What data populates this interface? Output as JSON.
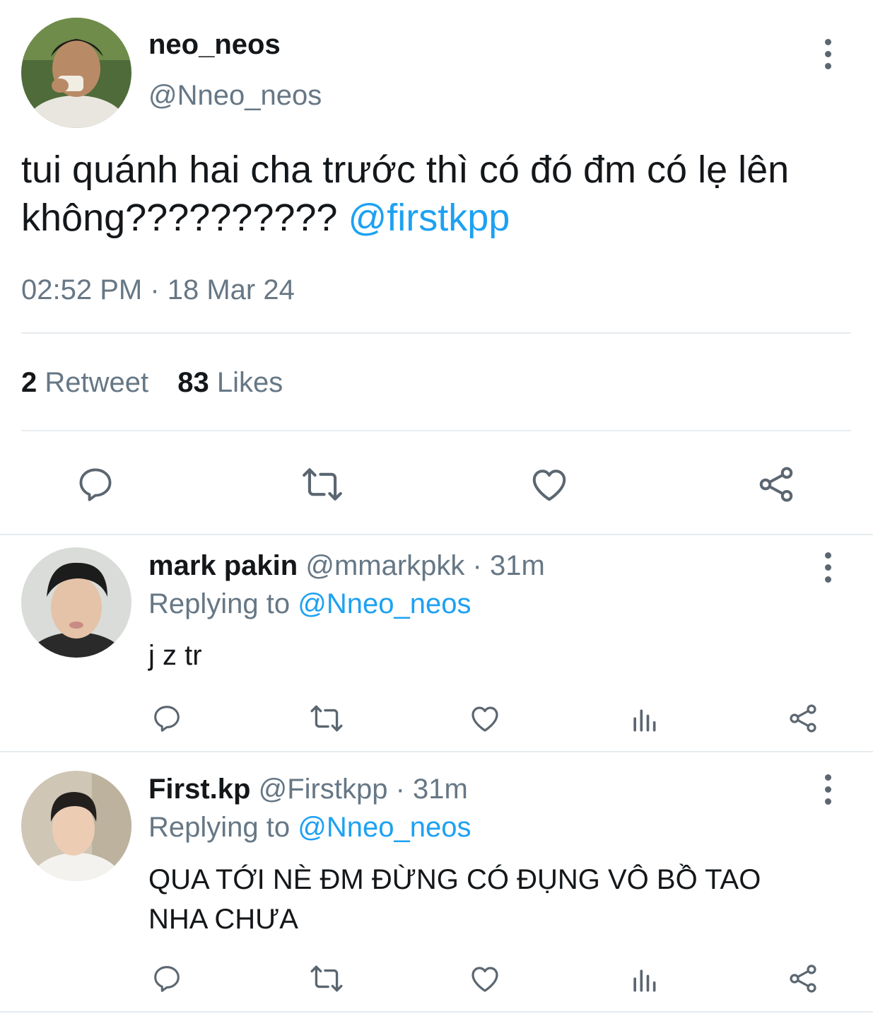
{
  "main_tweet": {
    "display_name": "neo_neos",
    "handle": "@Nneo_neos",
    "text": "tui quánh hai cha trước thì có đó đm có lẹ lên không??????????",
    "mention": "@firstkpp",
    "timestamp": "02:52 PM · 18 Mar 24",
    "retweet_count": "2",
    "retweet_label": "Retweet",
    "likes_count": "83",
    "likes_label": "Likes"
  },
  "replies": [
    {
      "display_name": "mark pakin",
      "handle": "@mmarkpkk",
      "separator": "·",
      "time": "31m",
      "replying_prefix": "Replying to",
      "replying_handle": "@Nneo_neos",
      "text": "j z tr"
    },
    {
      "display_name": "First.kp",
      "handle": "@Firstkpp",
      "separator": "·",
      "time": "31m",
      "replying_prefix": "Replying to",
      "replying_handle": "@Nneo_neos",
      "text_line1": "QUA TỚI NÈ ĐM ĐỪNG CÓ ĐỤNG VÔ BỒ TAO",
      "text_line2": "NHA CHƯA"
    }
  ],
  "icons": {
    "reply": "reply-icon",
    "retweet": "retweet-icon",
    "like": "heart-icon",
    "analytics": "analytics-icon",
    "share": "share-icon",
    "more": "more-vertical-icon"
  },
  "colors": {
    "text": "#14171a",
    "secondary": "#667785",
    "link": "#1da1f2",
    "icon": "#5b6670",
    "divider": "#e6ecf0"
  }
}
